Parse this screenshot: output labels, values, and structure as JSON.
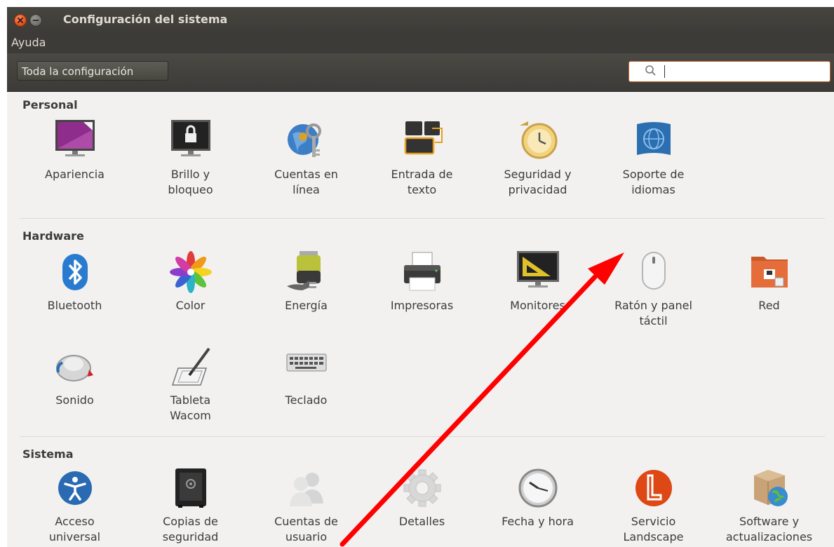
{
  "window": {
    "title": "Configuración del sistema",
    "menu": [
      "Ayuda"
    ]
  },
  "toolbar": {
    "all_settings_label": "Toda la configuración",
    "search_value": ""
  },
  "sections": {
    "personal": {
      "title": "Personal",
      "items": [
        {
          "label": "Apariencia",
          "icon": "appearance-icon"
        },
        {
          "label": "Brillo y\nbloqueo",
          "icon": "brightness-lock-icon"
        },
        {
          "label": "Cuentas en\nlínea",
          "icon": "online-accounts-icon"
        },
        {
          "label": "Entrada de\ntexto",
          "icon": "text-entry-icon"
        },
        {
          "label": "Seguridad y\nprivacidad",
          "icon": "security-privacy-icon"
        },
        {
          "label": "Soporte de\nidiomas",
          "icon": "language-support-icon"
        }
      ]
    },
    "hardware": {
      "title": "Hardware",
      "items": [
        {
          "label": "Bluetooth",
          "icon": "bluetooth-icon"
        },
        {
          "label": "Color",
          "icon": "color-icon"
        },
        {
          "label": "Energía",
          "icon": "power-icon"
        },
        {
          "label": "Impresoras",
          "icon": "printer-icon"
        },
        {
          "label": "Monitores",
          "icon": "displays-icon"
        },
        {
          "label": "Ratón y panel\ntáctil",
          "icon": "mouse-icon"
        },
        {
          "label": "Red",
          "icon": "network-icon"
        },
        {
          "label": "Sonido",
          "icon": "sound-icon"
        },
        {
          "label": "Tableta\nWacom",
          "icon": "wacom-tablet-icon"
        },
        {
          "label": "Teclado",
          "icon": "keyboard-icon"
        }
      ]
    },
    "sistema": {
      "title": "Sistema",
      "items": [
        {
          "label": "Acceso\nuniversal",
          "icon": "universal-access-icon"
        },
        {
          "label": "Copias de\nseguridad",
          "icon": "backups-icon"
        },
        {
          "label": "Cuentas de\nusuario",
          "icon": "user-accounts-icon"
        },
        {
          "label": "Detalles",
          "icon": "details-gear-icon"
        },
        {
          "label": "Fecha y hora",
          "icon": "clock-icon"
        },
        {
          "label": "Servicio\nLandscape",
          "icon": "landscape-icon"
        },
        {
          "label": "Software y\nactualizaciones",
          "icon": "software-updates-icon"
        }
      ]
    }
  },
  "colors": {
    "annotation_arrow": "#ff0000",
    "accent_orange": "#dd4814",
    "titlebar": "#3c3b37"
  }
}
